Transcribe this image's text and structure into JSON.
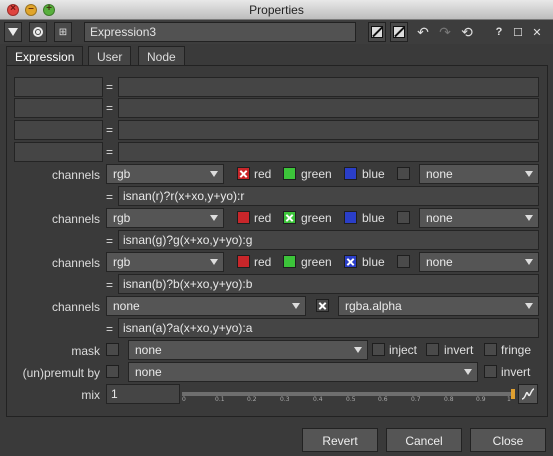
{
  "window": {
    "title": "Properties"
  },
  "toolbar": {
    "node_name": "Expression3",
    "help": "?",
    "float": "☐",
    "close": "✕"
  },
  "tabs": [
    {
      "label": "Expression"
    },
    {
      "label": "User"
    },
    {
      "label": "Node"
    }
  ],
  "temps": [
    {
      "name": "",
      "value": ""
    },
    {
      "name": "",
      "value": ""
    },
    {
      "name": "",
      "value": ""
    },
    {
      "name": "",
      "value": ""
    }
  ],
  "eq": "=",
  "channel_rows": [
    {
      "label": "channels",
      "layer": "rgb",
      "r_label": "red",
      "g_label": "green",
      "b_label": "blue",
      "extra": "none",
      "expr": "isnan(r)?r(x+xo,y+yo):r",
      "colors": {
        "r": "#c8262a",
        "g": "#3cc43a",
        "b": "#2a3ec8"
      }
    },
    {
      "label": "channels",
      "layer": "rgb",
      "r_label": "red",
      "g_label": "green",
      "b_label": "blue",
      "extra": "none",
      "expr": "isnan(g)?g(x+xo,y+yo):g"
    },
    {
      "label": "channels",
      "layer": "rgb",
      "r_label": "red",
      "g_label": "green",
      "b_label": "blue",
      "extra": "none",
      "expr": "isnan(b)?b(x+xo,y+yo):b"
    }
  ],
  "alpha_row": {
    "label": "channels",
    "layer": "none",
    "channel": "rgba.alpha",
    "expr": "isnan(a)?a(x+xo,y+yo):a"
  },
  "mask_row": {
    "label": "mask",
    "value": "none",
    "inject": "inject",
    "invert": "invert",
    "fringe": "fringe"
  },
  "unpremult_row": {
    "label": "(un)premult by",
    "value": "none",
    "invert": "invert"
  },
  "mix": {
    "label": "mix",
    "value": "1",
    "level": 1.0,
    "ticks": [
      "0",
      "0.1",
      "0.2",
      "0.3",
      "0.4",
      "0.5",
      "0.6",
      "0.7",
      "0.8",
      "0.9",
      "1"
    ]
  },
  "footer": {
    "revert": "Revert",
    "cancel": "Cancel",
    "close": "Close"
  }
}
